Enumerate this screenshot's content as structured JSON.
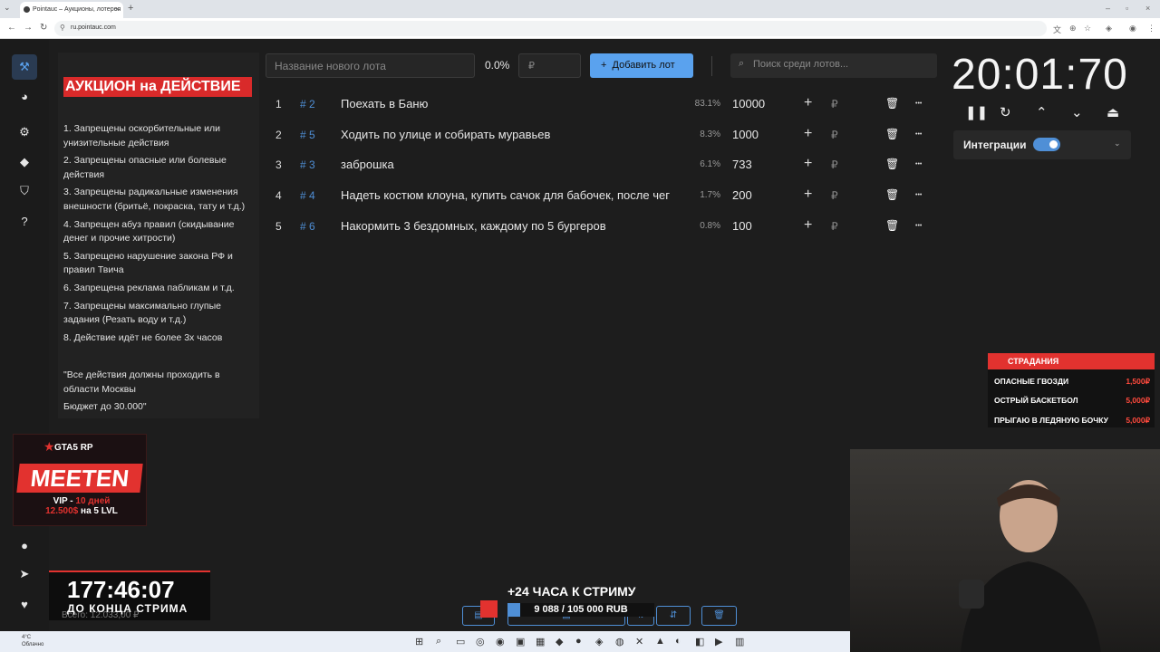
{
  "browser": {
    "tab_title": "Pointauc – Аукционы, лотерея",
    "url": "ru.pointauc.com"
  },
  "rules": {
    "title": "АУКЦИОН на ДЕЙСТВИЕ",
    "items": [
      "1. Запрещены оскорбительные или унизительные действия",
      "2. Запрещены опасные или болевые действия",
      "3. Запрещены радикальные изменения внешности (бритьё, покраска, тату и т.д.)",
      "4. Запрещен абуз правил (скидывание денег и прочие хитрости)",
      "5. Запрещено нарушение закона РФ и правил Твича",
      "6. Запрещена реклама пабликам и т.д.",
      "7.  Запрещены максимально глупые задания (Резать воду и т.д.)",
      "8. Действие идёт не более 3х часов"
    ],
    "note": "\"Все действия должны проходить в области Москвы",
    "budget": "Бюджет до 30.000\""
  },
  "toolbar": {
    "lot_placeholder": "Название нового лота",
    "percent": "0.0%",
    "rub_placeholder": "₽",
    "add_label": "Добавить лот",
    "search_placeholder": "Поиск среди лотов..."
  },
  "lots": [
    {
      "num": "1",
      "id": "# 2",
      "name": "Поехать в Баню",
      "pct": "83.1%",
      "value": "10000"
    },
    {
      "num": "2",
      "id": "# 5",
      "name": "Ходить по улице и собирать муравьев",
      "pct": "8.3%",
      "value": "1000"
    },
    {
      "num": "3",
      "id": "# 3",
      "name": "заброшка",
      "pct": "6.1%",
      "value": "733"
    },
    {
      "num": "4",
      "id": "# 4",
      "name": "Надеть костюм клоуна, купить сачок для бабочек, после чег",
      "pct": "1.7%",
      "value": "200"
    },
    {
      "num": "5",
      "id": "# 6",
      "name": "Накормить 3 бездомных, каждому по 5 бургеров",
      "pct": "0.8%",
      "value": "100"
    }
  ],
  "rub_symbol": "₽",
  "timer": {
    "value": "20:01:70",
    "integrations_label": "Интеграции"
  },
  "stradaniya": {
    "title": "СТРАДАНИЯ",
    "items": [
      {
        "name": "ОПАСНЫЕ ГВОЗДИ",
        "price": "1,500₽"
      },
      {
        "name": "ОСТРЫЙ БАСКЕТБОЛ",
        "price": "5,000₽"
      },
      {
        "name": "ПРЫГАЮ В ЛЕДЯНУЮ БОЧКУ",
        "price": "5,000₽"
      }
    ]
  },
  "promo": {
    "game": "GTA5 RP",
    "title": "MEETEN",
    "vip_prefix": "VIP - ",
    "vip_days": "10 дней",
    "price": "12.500$",
    "level": " на 5 LVL"
  },
  "countdown": {
    "time": "177:46:07",
    "label": "ДО КОНЦА СТРИМА",
    "total": "Всего: 12.033,00 ₽"
  },
  "goal": {
    "title": "+24 ЧАСА К СТРИМУ",
    "progress_text": "9 088 / 105 000 RUB",
    "fraction": 0.0866
  },
  "taskbar": {
    "weather_temp": "4°C",
    "weather_text": "Облачно"
  },
  "colors": {
    "accent": "#4f8fd6",
    "danger": "#e2322f"
  }
}
